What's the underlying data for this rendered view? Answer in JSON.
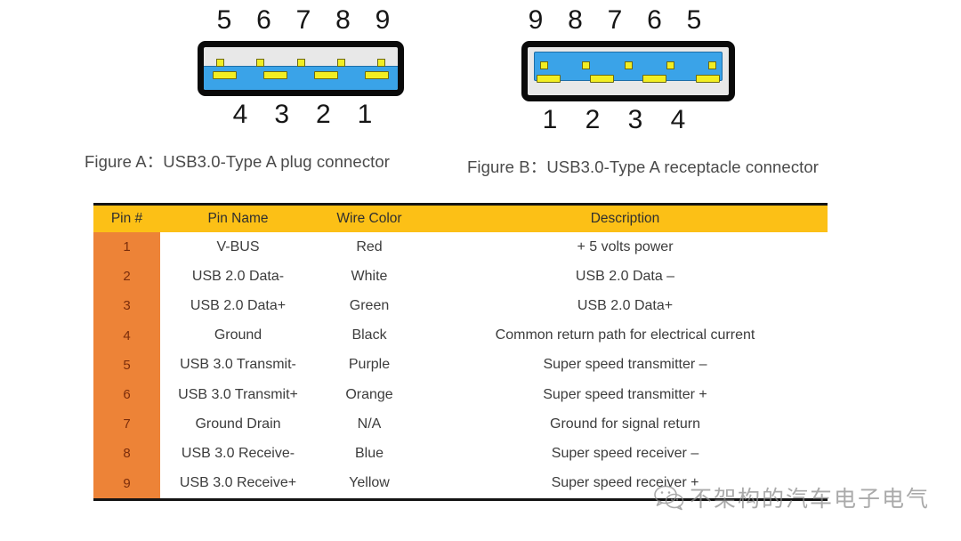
{
  "figures": [
    {
      "id": "plug",
      "caption": "Figure A：USB3.0-Type A plug connector",
      "top_pins": [
        "5",
        "6",
        "7",
        "8",
        "9"
      ],
      "bottom_pins": [
        "4",
        "3",
        "2",
        "1"
      ],
      "shell_color": "#e8e8e8",
      "band_color": "#3aa3e8",
      "contact_color": "#f2ee22"
    },
    {
      "id": "receptacle",
      "caption": "Figure B：USB3.0-Type A receptacle connector",
      "top_pins": [
        "9",
        "8",
        "7",
        "6",
        "5"
      ],
      "bottom_pins": [
        "1",
        "2",
        "3",
        "4"
      ],
      "shell_color": "#e8e8e8",
      "band_color": "#3aa3e8",
      "contact_color": "#f2ee22"
    }
  ],
  "table": {
    "header_bg": "#fcc016",
    "pin_cell_bg": "#ed8337",
    "columns": [
      "Pin #",
      "Pin Name",
      "Wire Color",
      "Description"
    ],
    "rows": [
      {
        "pin": "1",
        "name": "V-BUS",
        "color": "Red",
        "description": "+ 5 volts power"
      },
      {
        "pin": "2",
        "name": "USB 2.0 Data-",
        "color": "White",
        "description": "USB 2.0 Data –"
      },
      {
        "pin": "3",
        "name": "USB 2.0 Data+",
        "color": "Green",
        "description": "USB 2.0 Data+"
      },
      {
        "pin": "4",
        "name": "Ground",
        "color": "Black",
        "description": "Common return path for electrical current"
      },
      {
        "pin": "5",
        "name": "USB 3.0 Transmit-",
        "color": "Purple",
        "description": "Super speed transmitter –"
      },
      {
        "pin": "6",
        "name": "USB 3.0 Transmit+",
        "color": "Orange",
        "description": "Super speed transmitter +"
      },
      {
        "pin": "7",
        "name": "Ground Drain",
        "color": "N/A",
        "description": "Ground for signal return"
      },
      {
        "pin": "8",
        "name": "USB 3.0 Receive-",
        "color": "Blue",
        "description": "Super speed receiver –"
      },
      {
        "pin": "9",
        "name": "USB 3.0 Receive+",
        "color": "Yellow",
        "description": "Super speed receiver +"
      }
    ]
  },
  "watermark": {
    "icon": "wechat-icon",
    "text": "不架构的汽车电子电气"
  }
}
